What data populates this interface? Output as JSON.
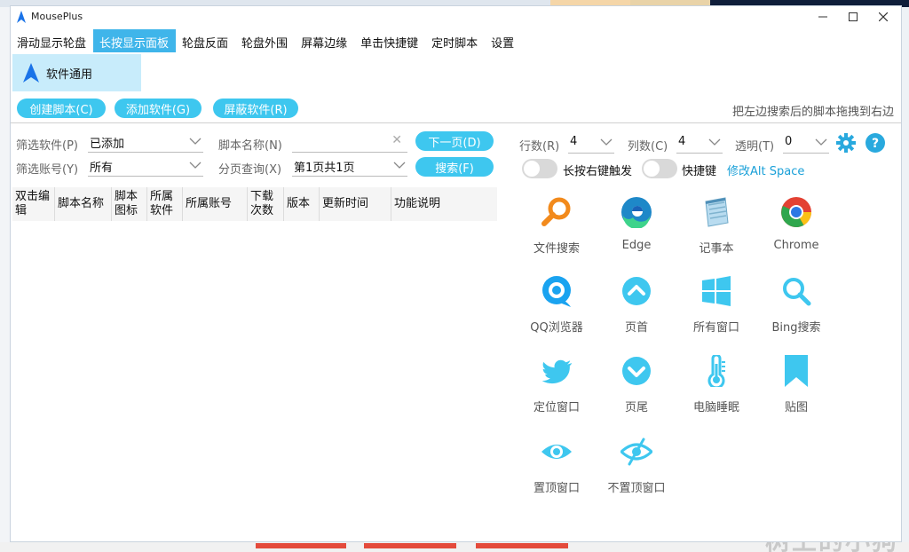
{
  "app": {
    "title": "MousePlus"
  },
  "menu": [
    "滑动显示轮盘",
    "长按显示面板",
    "轮盘反面",
    "轮盘外围",
    "屏幕边缘",
    "单击快捷键",
    "定时脚本",
    "设置"
  ],
  "sidebar": {
    "tab_label": "软件通用"
  },
  "actions": {
    "create": "创建脚本(C)",
    "add": "添加软件(G)",
    "block": "屏蔽软件(R)",
    "hint": "把左边搜索后的脚本拖拽到右边"
  },
  "filters": {
    "software_label": "筛选软件(P)",
    "software_value": "已添加",
    "account_label": "筛选账号(Y)",
    "account_value": "所有",
    "script_name_label": "脚本名称(N)",
    "script_name_value": "",
    "page_label": "分页查询(X)",
    "page_value": "第1页共1页",
    "next_page": "下一页(D)",
    "search": "搜索(F)"
  },
  "table": {
    "headers": [
      "双击编辑",
      "脚本名称",
      "脚本图标",
      "所属软件",
      "所属账号",
      "下载次数",
      "版本",
      "更新时间",
      "功能说明"
    ]
  },
  "panel": {
    "rows_label": "行数(R)",
    "rows_value": "4",
    "cols_label": "列数(C)",
    "cols_value": "4",
    "opacity_label": "透明(T)",
    "opacity_value": "0",
    "longpress_label": "长按右键触发",
    "hotkey_label": "快捷键",
    "hotkey_link": "修改Alt Space"
  },
  "tiles": [
    {
      "label": "文件搜索",
      "icon": "magnifier-orange-icon"
    },
    {
      "label": "Edge",
      "icon": "edge-icon"
    },
    {
      "label": "记事本",
      "icon": "notepad-icon"
    },
    {
      "label": "Chrome",
      "icon": "chrome-icon"
    },
    {
      "label": "QQ浏览器",
      "icon": "qq-browser-icon"
    },
    {
      "label": "页首",
      "icon": "chevron-up-circle-icon"
    },
    {
      "label": "所有窗口",
      "icon": "windows-icon"
    },
    {
      "label": "Bing搜索",
      "icon": "search-icon"
    },
    {
      "label": "定位窗口",
      "icon": "twitter-bird-icon"
    },
    {
      "label": "页尾",
      "icon": "chevron-down-circle-icon"
    },
    {
      "label": "电脑睡眠",
      "icon": "thermometer-icon"
    },
    {
      "label": "贴图",
      "icon": "bookmark-icon"
    },
    {
      "label": "置顶窗口",
      "icon": "eye-icon"
    },
    {
      "label": "不置顶窗口",
      "icon": "eye-slash-icon"
    }
  ],
  "watermark": "树上的小狗",
  "colors": {
    "accent": "#3ec7ef",
    "menu_active": "#3fb5ea",
    "sidebar_active": "#c8ecfb",
    "link": "#1aa0d8"
  }
}
